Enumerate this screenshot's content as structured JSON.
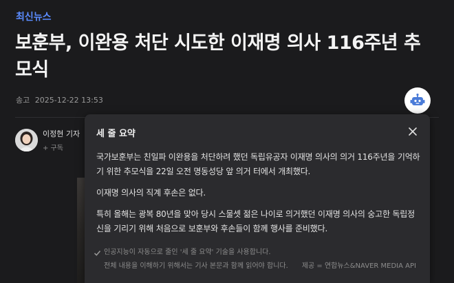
{
  "article": {
    "category": "최신뉴스",
    "headline": "보훈부, 이완용 처단 시도한 이재명 의사 116주년 추모식",
    "sent_label": "송고",
    "timestamp": "2025-12-22 13:53",
    "author_name": "이정현 기자",
    "subscribe_label": "+ 구독"
  },
  "summary_panel": {
    "title": "세 줄 요약",
    "paragraphs": [
      "국가보훈부는 친일파 이완용을 처단하려 했던 독립유공자 이재명 의사의 의거 116주년을 기억하기 위한 추모식을 22일 오전 명동성당 앞 의거 터에서 개최했다.",
      "이재명 의사의 직계 후손은 없다.",
      "특히 올해는 광복 80년을 맞아 당시 스물셋 젊은 나이로 의거했던 이재명 의사의 숭고한 독립정신을 기리기 위해 처음으로 보훈부와 후손들이 함께 행사를 준비했다."
    ],
    "notice_line1": "인공지능이 자동으로 줄인 '세 줄 요약' 기술을 사용합니다.",
    "notice_line2": "전체 내용을 이해하기 위해서는 기사 본문과 함께 읽어야 합니다.",
    "source": "제공 = 연합뉴스&NAVER MEDIA API"
  },
  "icons": {
    "bot": "robot-icon",
    "close": "close-icon",
    "check": "check-icon"
  },
  "colors": {
    "background": "#1b1b1d",
    "category": "#5b8cff",
    "panel": "#2b2b2e",
    "bot_icon": "#4a7bd8"
  }
}
